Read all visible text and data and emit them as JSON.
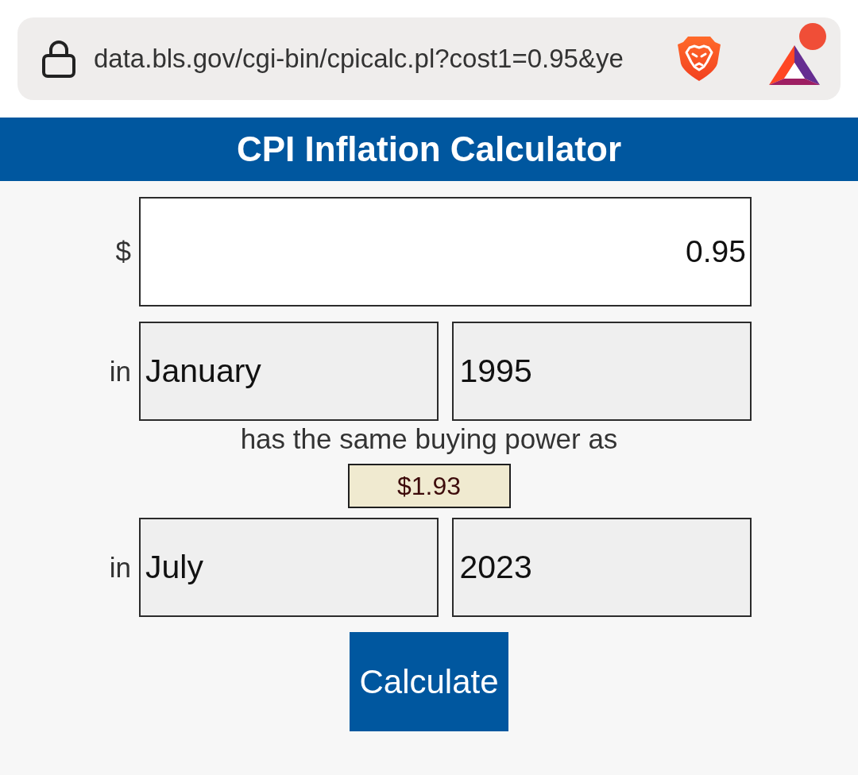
{
  "browser": {
    "url": "data.bls.gov/cgi-bin/cpicalc.pl?cost1=0.95&ye"
  },
  "header": {
    "title": "CPI Inflation Calculator"
  },
  "form": {
    "amount": {
      "label": "$",
      "value": "0.95"
    },
    "from": {
      "label": "in",
      "month": "January",
      "year": "1995"
    },
    "middle_text": "has the same buying power as",
    "result": "$1.93",
    "to": {
      "label": "in",
      "month": "July",
      "year": "2023"
    },
    "button": "Calculate"
  }
}
